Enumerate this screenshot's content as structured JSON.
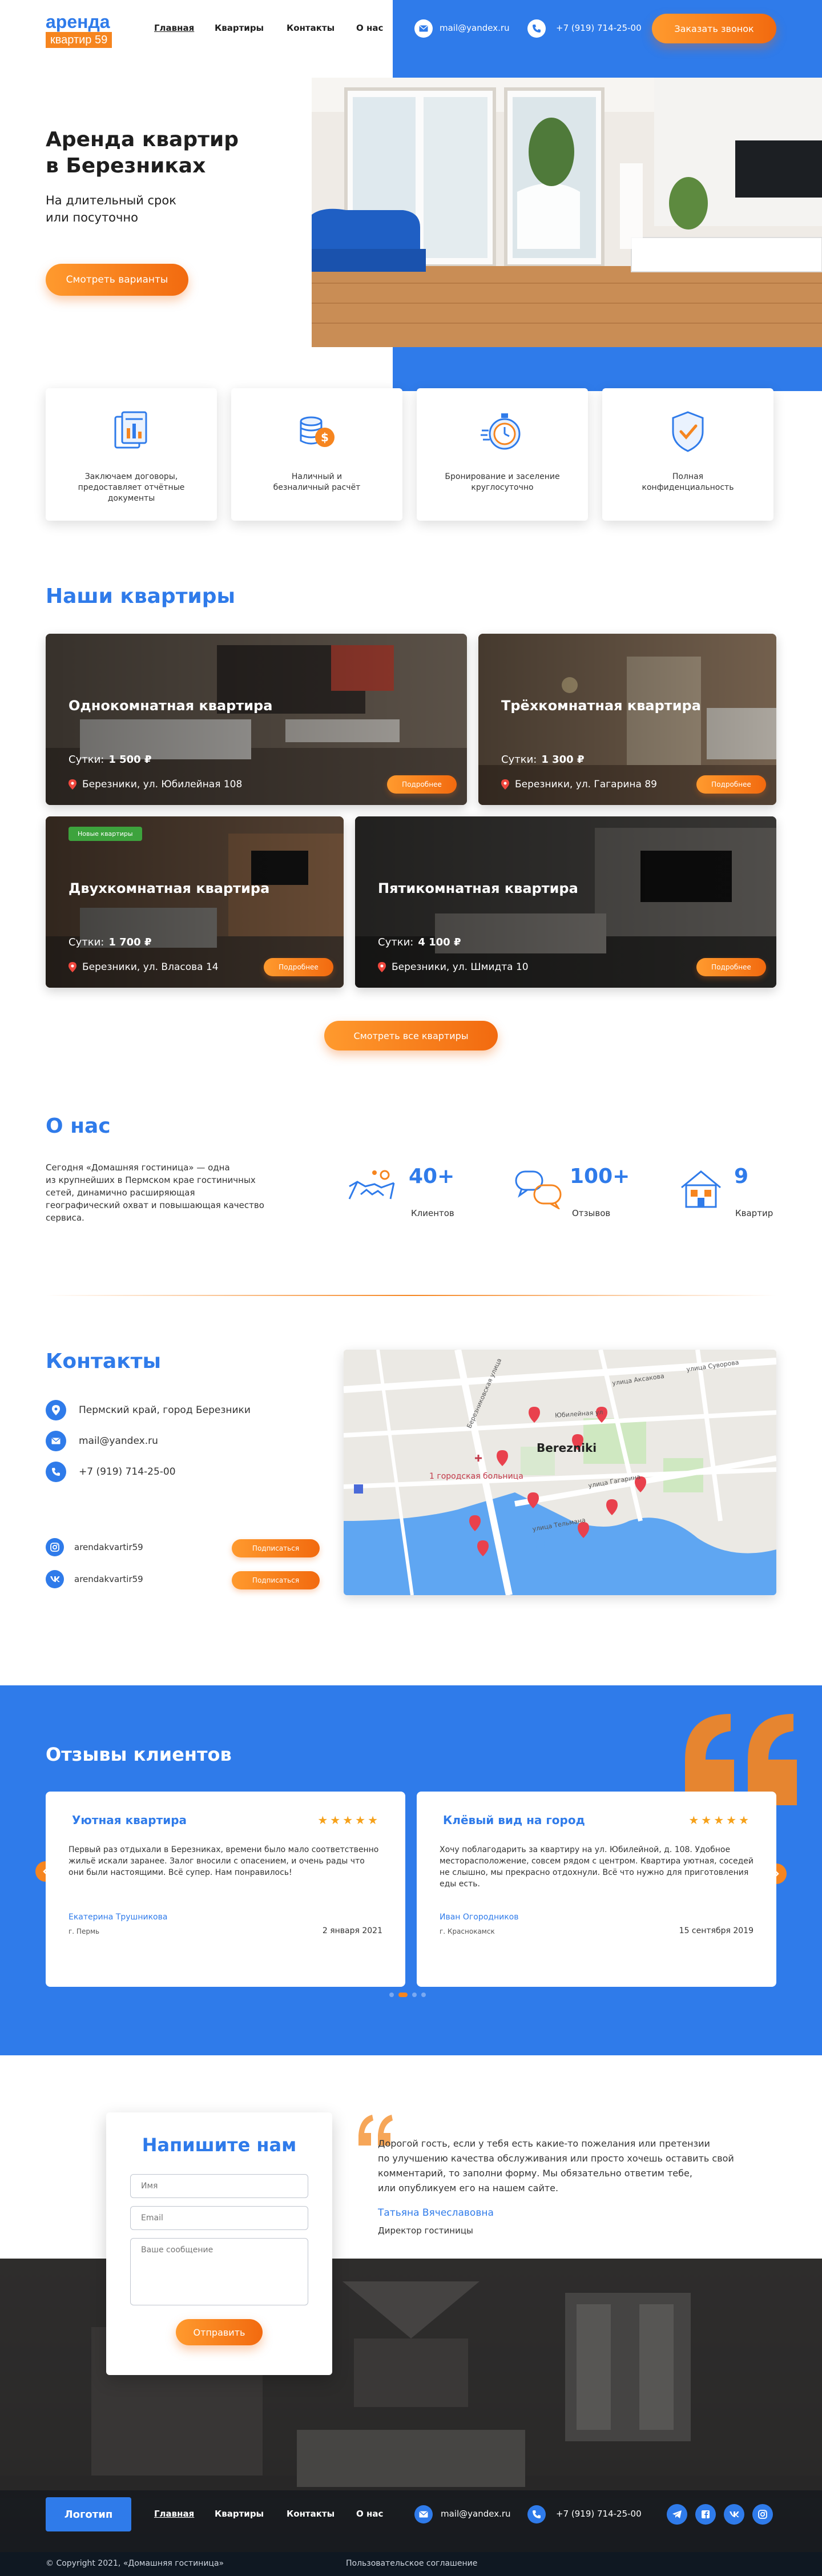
{
  "header": {
    "logo_line1": "аренда",
    "logo_line2": "квартир 59",
    "nav": [
      "Главная",
      "Квартиры",
      "Контакты",
      "О нас"
    ],
    "email": "mail@yandex.ru",
    "phone": "+7 (919) 714-25-00",
    "call_button": "Заказать звонок"
  },
  "hero": {
    "title_line1": "Аренда квартир",
    "title_line2": "в Березниках",
    "subtitle_line1": "На длительный срок",
    "subtitle_line2": "или посуточно",
    "button": "Смотреть варианты"
  },
  "features": [
    {
      "icon": "documents-icon",
      "line1": "Заключаем договоры,",
      "line2": "предоставляет отчётные",
      "line3": "документы"
    },
    {
      "icon": "coins-icon",
      "line1": "Наличный и",
      "line2": "безналичный расчёт",
      "line3": ""
    },
    {
      "icon": "stopwatch-icon",
      "line1": "Бронирование и заселение",
      "line2": "круглосуточно",
      "line3": ""
    },
    {
      "icon": "shield-check-icon",
      "line1": "Полная",
      "line2": "конфиденциальность",
      "line3": ""
    }
  ],
  "apartments": {
    "title": "Наши квартиры",
    "price_label": "Сутки:",
    "details_button": "Подробнее",
    "new_badge": "Новые квартиры",
    "show_all": "Смотреть все квартиры",
    "items": [
      {
        "name": "Однокомнатная квартира",
        "price": "1 500 ₽",
        "address": "Березники, ул. Юбилейная 108"
      },
      {
        "name": "Трёхкомнатная квартира",
        "price": "1 300 ₽",
        "address": "Березники, ул. Гагарина 89"
      },
      {
        "name": "Двухкомнатная квартира",
        "price": "1 700 ₽",
        "address": "Березники, ул. Власова 14"
      },
      {
        "name": "Пятикомнатная квартира",
        "price": "4 100 ₽",
        "address": "Березники, ул. Шмидта 10"
      }
    ]
  },
  "about": {
    "title": "О нас",
    "text_lines": [
      "Сегодня «Домашняя гостиница» — одна",
      "из крупнейших в Пермском крае гостиничных",
      "сетей, динамично расширяющая",
      "географический охват и повышающая качество",
      "сервиса."
    ],
    "stats": [
      {
        "icon": "handshake-icon",
        "value": "40+",
        "label": "Клиентов"
      },
      {
        "icon": "chat-bubbles-icon",
        "value": "100+",
        "label": "Отзывов"
      },
      {
        "icon": "house-icon",
        "value": "9",
        "label": "Квартир"
      }
    ]
  },
  "contacts": {
    "title": "Контакты",
    "address": "Пермский край, город Березники",
    "email": "mail@yandex.ru",
    "phone": "+7 (919) 714-25-00",
    "socials": [
      {
        "icon": "instagram-icon",
        "handle": "arendakvartir59",
        "button": "Подписаться"
      },
      {
        "icon": "vk-icon",
        "handle": "arendakvartir59",
        "button": "Подписаться"
      }
    ],
    "map": {
      "city": "Berezniki",
      "hospital": "1 городская больница",
      "streets": [
        "улица Аксакова",
        "улица Суворова",
        "Юбилейная ул",
        "Березниковская улица",
        "улица Гагарина",
        "улица Тельмана"
      ]
    }
  },
  "reviews": {
    "title": "Отзывы клиентов",
    "items": [
      {
        "title": "Уютная квартира",
        "stars": "★★★★★",
        "text": "Первый раз отдыхали в Березниках, времени было мало соответственно жильё искали заранее. Залог вносили с опасением, и очень рады что они были настоящими. Всё супер. Нам понравилось!",
        "name": "Екатерина Трушникова",
        "city": "г. Пермь",
        "date": "2 января 2021"
      },
      {
        "title": "Клёвый вид на город",
        "stars": "★★★★★",
        "text": "Хочу поблагодарить за квартиру на ул. Юбилейной, д. 108. Удобное месторасположение, совсем рядом с центром. Квартира уютная, соседей не слышно, мы прекрасно отдохнули. Всё что нужно для приготовления еды есть.",
        "name": "Иван Огородников",
        "city": "г. Краснокамск",
        "date": "15 сентября 2019"
      }
    ]
  },
  "form": {
    "title": "Напишите нам",
    "name_placeholder": "Имя",
    "email_placeholder": "Email",
    "message_placeholder": "Ваше сообщение",
    "submit": "Отправить",
    "quote_lines": [
      "Дорогой гость, если у тебя есть какие-то пожелания или претензии",
      "по улучшению качества обслуживания или просто хочешь оставить свой",
      "комментарий, то заполни форму. Мы обязательно ответим тебе,",
      "или опубликуем его на нашем сайте."
    ],
    "signature_name": "Татьяна Вячеславовна",
    "signature_role": "Директор гостиницы"
  },
  "footer": {
    "logo_button": "Логотип",
    "nav": [
      "Главная",
      "Квартиры",
      "Контакты",
      "О нас"
    ],
    "email": "mail@yandex.ru",
    "phone": "+7 (919) 714-25-00",
    "copyright": "© Copyright 2021, «Домашняя гостиница»",
    "agreement": "Пользовательское соглашение"
  },
  "colors": {
    "brand_blue": "#2f7bea",
    "accent_orange": "#f6851f",
    "dark_footer": "#0f1822"
  }
}
